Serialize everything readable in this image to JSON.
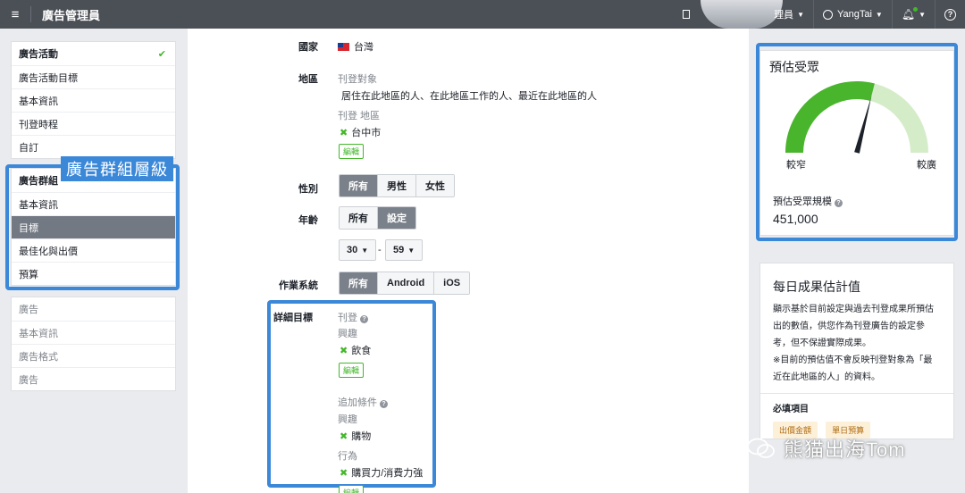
{
  "topbar": {
    "app_title": "廣告管理員",
    "account_label": "理員",
    "user_name": "YangTai"
  },
  "leftnav": {
    "campaign": [
      {
        "label": "廣告活動",
        "done": true
      },
      {
        "label": "廣告活動目標"
      },
      {
        "label": "基本資訊"
      },
      {
        "label": "刊登時程"
      },
      {
        "label": "自訂"
      }
    ],
    "adset": [
      {
        "label": "廣告群組"
      },
      {
        "label": "基本資訊"
      },
      {
        "label": "目標",
        "active": true
      },
      {
        "label": "最佳化與出價"
      },
      {
        "label": "預算"
      }
    ],
    "ad": [
      {
        "label": "廣告"
      },
      {
        "label": "基本資訊"
      },
      {
        "label": "廣告格式"
      },
      {
        "label": "廣告"
      }
    ],
    "annotation": "廣告群組層級"
  },
  "targeting": {
    "country_label": "國家",
    "country_value": "台灣",
    "region_label": "地區",
    "audience_heading": "刊登對象",
    "audience_value": "居住在此地區的人、在此地區工作的人、最近在此地區的人",
    "locations_heading": "刊登 地區",
    "location_value": "台中市",
    "edit_label": "編輯",
    "gender_label": "性別",
    "gender_options": [
      "所有",
      "男性",
      "女性"
    ],
    "age_label": "年齡",
    "age_options": [
      "所有",
      "設定"
    ],
    "age_min": "30",
    "age_dash": "-",
    "age_max": "59",
    "os_label": "作業系統",
    "os_options": [
      "所有",
      "Android",
      "iOS"
    ],
    "detailed_label": "詳細目標",
    "include_heading": "刊登",
    "interest_heading": "興趣",
    "interest_value": "飲食",
    "narrow_heading": "追加條件",
    "interest2_heading": "興趣",
    "interest2_value": "購物",
    "behavior_heading": "行為",
    "behavior_value": "購買力/消費力強"
  },
  "audience_card": {
    "title": "預估受眾",
    "narrow": "較窄",
    "broad": "較廣",
    "size_label": "預估受眾規模",
    "size_value": "451,000",
    "gauge_level": 0.58
  },
  "results_card": {
    "title": "每日成果估計值",
    "desc1": "顯示基於目前設定與過去刊登成果所預估",
    "desc2": "出的數值，供您作為刊登廣告的設定參",
    "desc3": "考，但不保證實際成果。",
    "note1": "※目前的預估值不會反映刊登對象為「最",
    "note2": "近在此地區的人」的資料。",
    "required_label": "必填項目",
    "tags": [
      "出價金額",
      "單日預算"
    ]
  },
  "watermark": "熊猫出海Tom",
  "colors": {
    "topbar": "#4b4f56",
    "highlight": "#3b88d8",
    "gauge_green": "#49b52d",
    "gauge_light": "#d5ecc9"
  }
}
